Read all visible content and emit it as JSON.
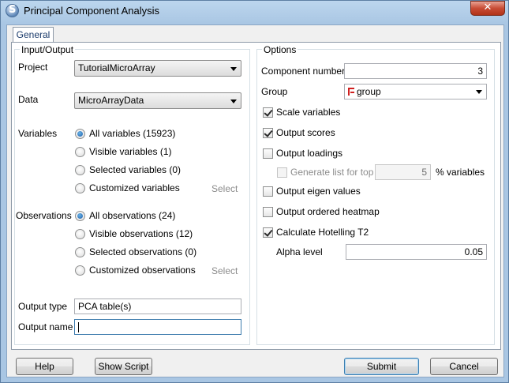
{
  "window": {
    "title": "Principal Component Analysis",
    "close_glyph": "✕"
  },
  "tabs": [
    {
      "label": "General"
    }
  ],
  "io": {
    "title": "Input/Output",
    "project_label": "Project",
    "project_value": "TutorialMicroArray",
    "data_label": "Data",
    "data_value": "MicroArrayData",
    "variables_label": "Variables",
    "variables_options": [
      {
        "label": "All variables (15923)",
        "selected": true
      },
      {
        "label": "Visible variables (1)",
        "selected": false
      },
      {
        "label": "Selected variables (0)",
        "selected": false
      },
      {
        "label": "Customized variables",
        "selected": false
      }
    ],
    "variables_select_label": "Select",
    "observations_label": "Observations",
    "observations_options": [
      {
        "label": "All observations (24)",
        "selected": true
      },
      {
        "label": "Visible observations (12)",
        "selected": false
      },
      {
        "label": "Selected observations (0)",
        "selected": false
      },
      {
        "label": "Customized observations",
        "selected": false
      }
    ],
    "observations_select_label": "Select",
    "output_type_label": "Output type",
    "output_type_value": "PCA table(s)",
    "output_name_label": "Output name",
    "output_name_value": ""
  },
  "options": {
    "title": "Options",
    "component_number_label": "Component number",
    "component_number_value": "3",
    "group_label": "Group",
    "group_value": "group",
    "scale_variables": {
      "label": "Scale variables",
      "checked": true
    },
    "output_scores": {
      "label": "Output scores",
      "checked": true
    },
    "output_loadings": {
      "label": "Output loadings",
      "checked": false
    },
    "generate_list": {
      "label": "Generate list for top",
      "checked": false,
      "value": "5",
      "suffix": "% variables"
    },
    "output_eigen": {
      "label": "Output eigen values",
      "checked": false
    },
    "output_heatmap": {
      "label": "Output ordered heatmap",
      "checked": false
    },
    "hotelling": {
      "label": "Calculate Hotelling T2",
      "checked": true
    },
    "alpha_label": "Alpha level",
    "alpha_value": "0.05"
  },
  "buttons": {
    "help": "Help",
    "show_script": "Show Script",
    "submit": "Submit",
    "cancel": "Cancel"
  }
}
